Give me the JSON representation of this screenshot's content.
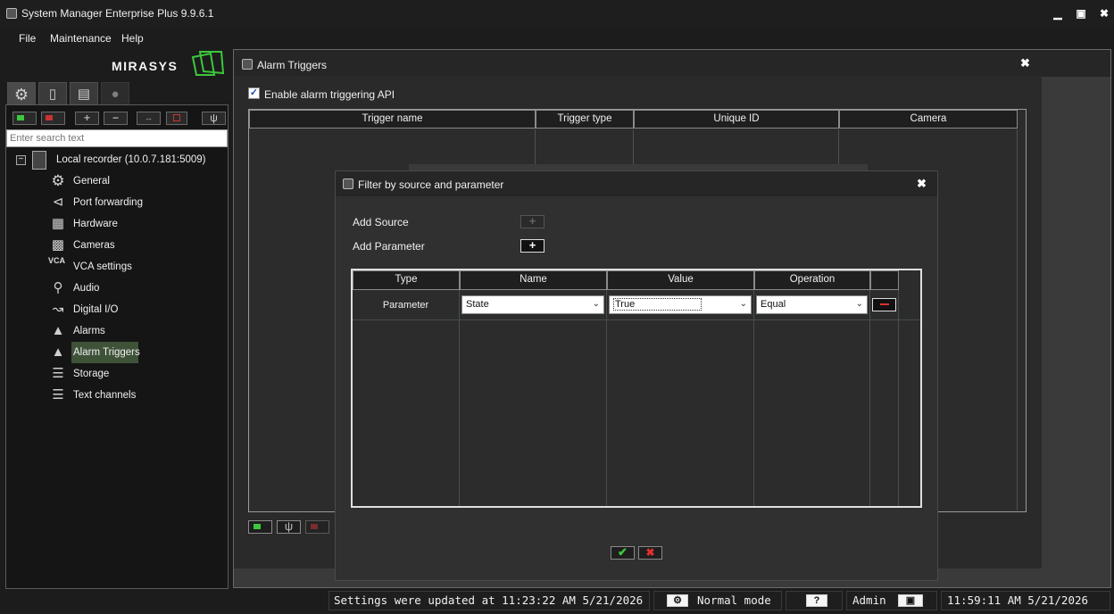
{
  "app": {
    "title": "System Manager Enterprise Plus 9.9.6.1"
  },
  "menu": [
    "File",
    "Maintenance",
    "Help"
  ],
  "brand": {
    "logo_text": "MIRASYS",
    "accent": "#3cc83c"
  },
  "sidebar": {
    "search_placeholder": "Enter search text",
    "root": {
      "label": "Local recorder (10.0.7.181:5009)",
      "icon": "server-icon",
      "expanded": true
    },
    "items": [
      {
        "label": "General",
        "icon": "gear-icon"
      },
      {
        "label": "Port forwarding",
        "icon": "share-icon"
      },
      {
        "label": "Hardware",
        "icon": "chip-icon"
      },
      {
        "label": "Cameras",
        "icon": "camera-icon"
      },
      {
        "label": "VCA settings",
        "icon": "vca-icon",
        "icon_text": "VCA"
      },
      {
        "label": "Audio",
        "icon": "microphone-icon"
      },
      {
        "label": "Digital I/O",
        "icon": "io-icon"
      },
      {
        "label": "Alarms",
        "icon": "bell-icon"
      },
      {
        "label": "Alarm Triggers",
        "icon": "bell-plus-icon",
        "selected": true
      },
      {
        "label": "Storage",
        "icon": "layers-icon"
      },
      {
        "label": "Text channels",
        "icon": "list-icon"
      }
    ]
  },
  "alarm_triggers": {
    "title": "Alarm Triggers",
    "enable_label": "Enable alarm triggering API",
    "enabled": true,
    "columns": [
      "Trigger name",
      "Trigger type",
      "Unique ID",
      "Camera"
    ]
  },
  "filter_dialog": {
    "title": "Filter by source and parameter",
    "add_source_label": "Add Source",
    "add_parameter_label": "Add Parameter",
    "columns": [
      "Type",
      "Name",
      "Value",
      "Operation"
    ],
    "rows": [
      {
        "type": "Parameter",
        "name": "State",
        "value": "True",
        "operation": "Equal"
      }
    ]
  },
  "status_bar": {
    "message": "Settings were updated at 11:23:22 AM 5/21/2026",
    "mode": "Normal mode",
    "help": "?",
    "user": "Admin",
    "clock": "11:59:11 AM 5/21/2026"
  }
}
